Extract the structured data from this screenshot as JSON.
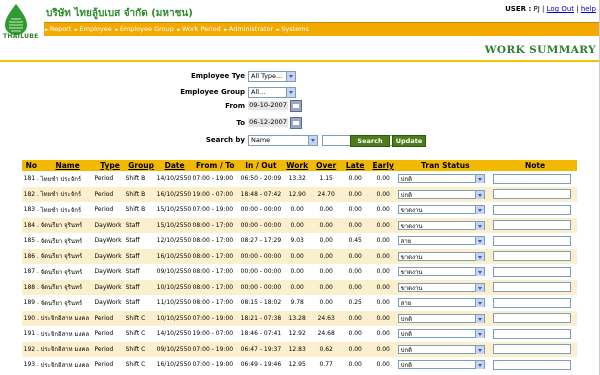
{
  "company": {
    "logo_text": "THAILUBE",
    "name": "บริษัท ไทยลู้บเบส จำกัด (มหาชน)"
  },
  "user": {
    "label": "USER :",
    "name": "PJ",
    "logout": "Log Out",
    "help": "help",
    "sep": "|"
  },
  "nav": {
    "items": [
      "Report",
      "Employee",
      "Employee Group",
      "Work Period",
      "Administrator",
      "Systems"
    ]
  },
  "page": {
    "title": "WORK SUMMARY"
  },
  "filters": {
    "employee_type_label": "Employee Tye",
    "employee_type_value": "All Type...",
    "employee_group_label": "Employee Group",
    "employee_group_value": "All...",
    "from_label": "From",
    "from_value": "09-10-2007",
    "to_label": "To",
    "to_value": "06-12-2007",
    "search_by_label": "Search  by",
    "search_by_value": "Name",
    "search_text": "",
    "search_button": "Search",
    "update_button": "Update"
  },
  "table": {
    "headers": [
      "No",
      "Name",
      "Type",
      "Group",
      "Date",
      "From / To",
      "In / Out",
      "Work",
      "Over",
      "Late",
      "Early",
      "Tran Status",
      "Note"
    ],
    "rows": [
      {
        "no": "181 .",
        "name": "ไทยชำ ประจักร์",
        "type": "Period",
        "group": "Shift B",
        "date": "14/10/2550",
        "fromto": "07:00 - 19:00",
        "inout": "06:50 - 20:09",
        "work": "13.32",
        "over": "1.15",
        "late": "0.00",
        "early": "0.00",
        "status": "ปกติ",
        "note": ""
      },
      {
        "no": "182 .",
        "name": "ไทยชำ ประจักร์",
        "type": "Period",
        "group": "Shift B",
        "date": "16/10/2550",
        "fromto": "19:00 - 07:00",
        "inout": "18:48 - 07:42",
        "work": "12.90",
        "over": "24.70",
        "late": "0.00",
        "early": "0.00",
        "status": "ปกติ",
        "note": ""
      },
      {
        "no": "183 .",
        "name": "ไทยชำ ประจักร์",
        "type": "Period",
        "group": "Shift B",
        "date": "15/10/2550",
        "fromto": "07:00 - 19:00",
        "inout": "00:00 - 00:00",
        "work": "0.00",
        "over": "0.00",
        "late": "0.00",
        "early": "0.00",
        "status": "ขาดงาน",
        "note": ""
      },
      {
        "no": "184 .",
        "name": "จัดนรียา จุรินทร์",
        "type": "DayWork",
        "group": "Staff",
        "date": "15/10/2550",
        "fromto": "08:00 - 17:00",
        "inout": "00:00 - 00:00",
        "work": "0.00",
        "over": "0.00",
        "late": "0.00",
        "early": "0.00",
        "status": "ขาดงาน",
        "note": ""
      },
      {
        "no": "185 .",
        "name": "จัดนรียา จุรินทร์",
        "type": "DayWork",
        "group": "Staff",
        "date": "12/10/2550",
        "fromto": "08:00 - 17:00",
        "inout": "08:27 - 17:29",
        "work": "9.03",
        "over": "0.00",
        "late": "0.45",
        "early": "0.00",
        "status": "สาย",
        "note": ""
      },
      {
        "no": "186 .",
        "name": "จัดนรียา จุรินทร์",
        "type": "DayWork",
        "group": "Staff",
        "date": "16/10/2550",
        "fromto": "08:00 - 17:00",
        "inout": "00:00 - 00:00",
        "work": "0.00",
        "over": "0.00",
        "late": "0.00",
        "early": "0.00",
        "status": "ขาดงาน",
        "note": ""
      },
      {
        "no": "187 .",
        "name": "จัดนรียา จุรินทร์",
        "type": "DayWork",
        "group": "Staff",
        "date": "09/10/2550",
        "fromto": "08:00 - 17:00",
        "inout": "00:00 - 00:00",
        "work": "0.00",
        "over": "0.00",
        "late": "0.00",
        "early": "0.00",
        "status": "ขาดงาน",
        "note": ""
      },
      {
        "no": "188 .",
        "name": "จัดนรียา จุรินทร์",
        "type": "DayWork",
        "group": "Staff",
        "date": "10/10/2550",
        "fromto": "08:00 - 17:00",
        "inout": "00:00 - 00:00",
        "work": "0.00",
        "over": "0.00",
        "late": "0.00",
        "early": "0.00",
        "status": "ขาดงาน",
        "note": ""
      },
      {
        "no": "189 .",
        "name": "จัดนรียา จุรินทร์",
        "type": "DayWork",
        "group": "Staff",
        "date": "11/10/2550",
        "fromto": "08:00 - 17:00",
        "inout": "08:15 - 18:02",
        "work": "9.78",
        "over": "0.00",
        "late": "0.25",
        "early": "0.00",
        "status": "สาย",
        "note": ""
      },
      {
        "no": "190 .",
        "name": "ประจิกอิสาห มงคล",
        "type": "Period",
        "group": "Shift C",
        "date": "10/10/2550",
        "fromto": "07:00 - 19:00",
        "inout": "18:21 - 07:38",
        "work": "13.28",
        "over": "24.63",
        "late": "0.00",
        "early": "0.00",
        "status": "ปกติ",
        "note": ""
      },
      {
        "no": "191 .",
        "name": "ประจิกอิสาห มงคล",
        "type": "Period",
        "group": "Shift C",
        "date": "14/10/2550",
        "fromto": "19:00 - 07:00",
        "inout": "18:46 - 07:41",
        "work": "12.92",
        "over": "24.68",
        "late": "0.00",
        "early": "0.00",
        "status": "ปกติ",
        "note": ""
      },
      {
        "no": "192 .",
        "name": "ประจิกอิสาห มงคล",
        "type": "Period",
        "group": "Shift C",
        "date": "09/10/2550",
        "fromto": "07:00 - 19:00",
        "inout": "06:47 - 19:37",
        "work": "12.83",
        "over": "0.62",
        "late": "0.00",
        "early": "0.00",
        "status": "ปกติ",
        "note": ""
      },
      {
        "no": "193 .",
        "name": "ประจิกอิสาห มงคล",
        "type": "Period",
        "group": "Shift C",
        "date": "16/10/2550",
        "fromto": "07:00 - 19:00",
        "inout": "06:49 - 19:46",
        "work": "12.95",
        "over": "0.77",
        "late": "0.00",
        "early": "0.00",
        "status": "ปกติ",
        "note": ""
      }
    ]
  },
  "colors": {
    "nav": "#f2a900",
    "header_row": "#f2b900",
    "alt_row": "#fbf0cd",
    "title": "#2f7d2f",
    "button": "#4c7d1a"
  }
}
